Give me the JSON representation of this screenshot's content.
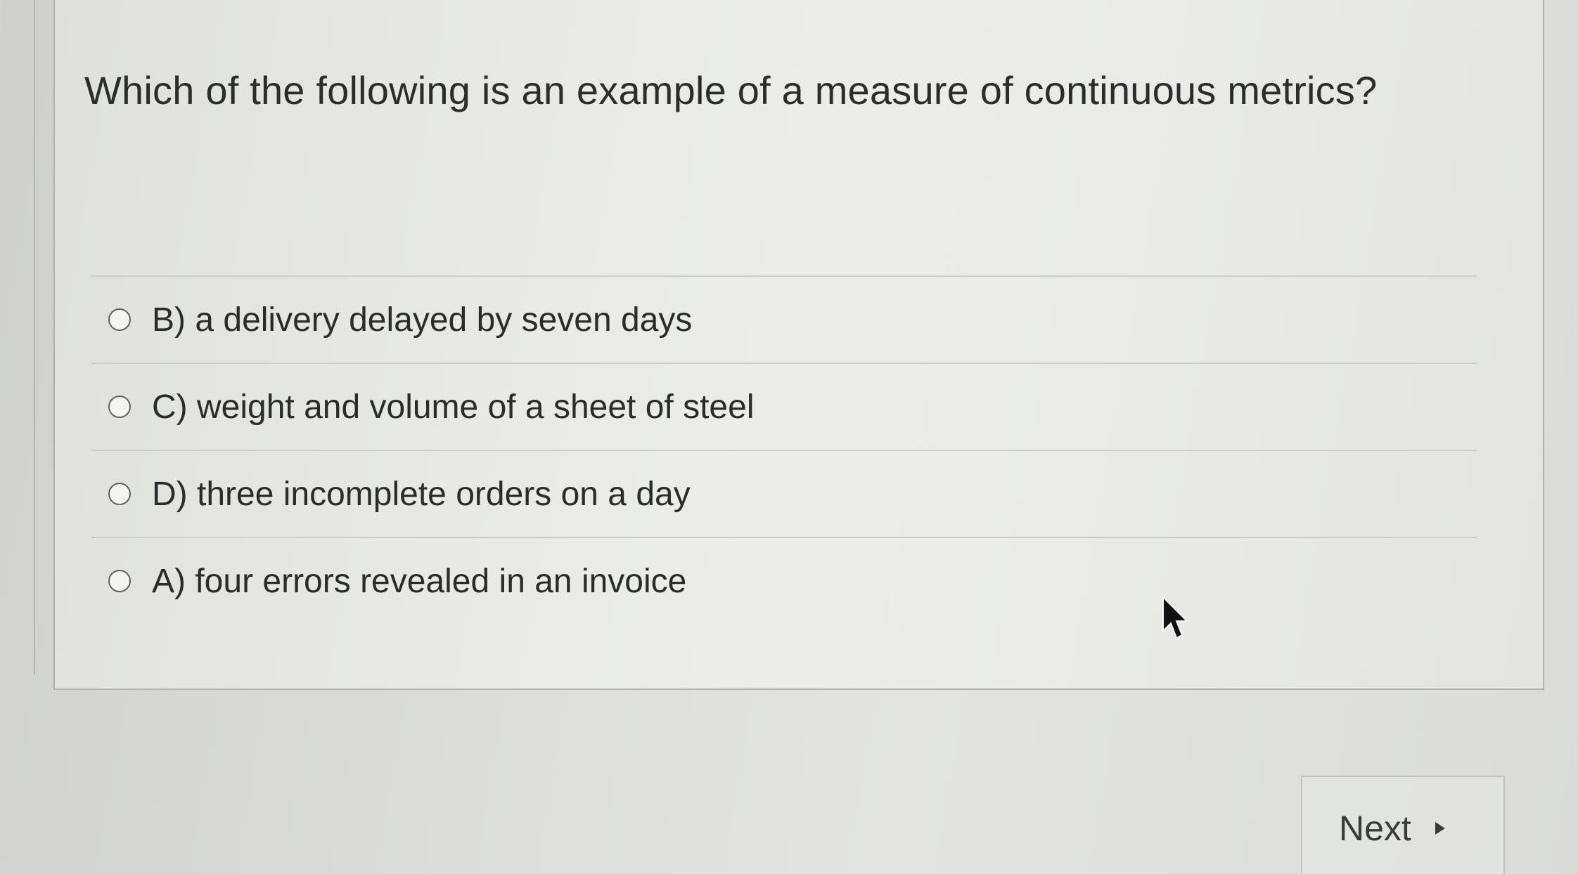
{
  "question": {
    "text": "Which of the following is an example of a measure of continuous metrics?"
  },
  "options": [
    {
      "label": "B) a delivery delayed by seven days",
      "selected": false
    },
    {
      "label": "C) weight and volume of a sheet of steel",
      "selected": false
    },
    {
      "label": "D) three incomplete orders on a day",
      "selected": false
    },
    {
      "label": "A) four errors revealed in an invoice",
      "selected": false
    }
  ],
  "navigation": {
    "next_label": "Next",
    "next_icon": "play-arrow-icon"
  },
  "cursor": {
    "icon": "mouse-pointer-icon"
  },
  "colors": {
    "background": "#dcddd9",
    "text": "#2b2c2c",
    "border": "#b1b2ae"
  }
}
